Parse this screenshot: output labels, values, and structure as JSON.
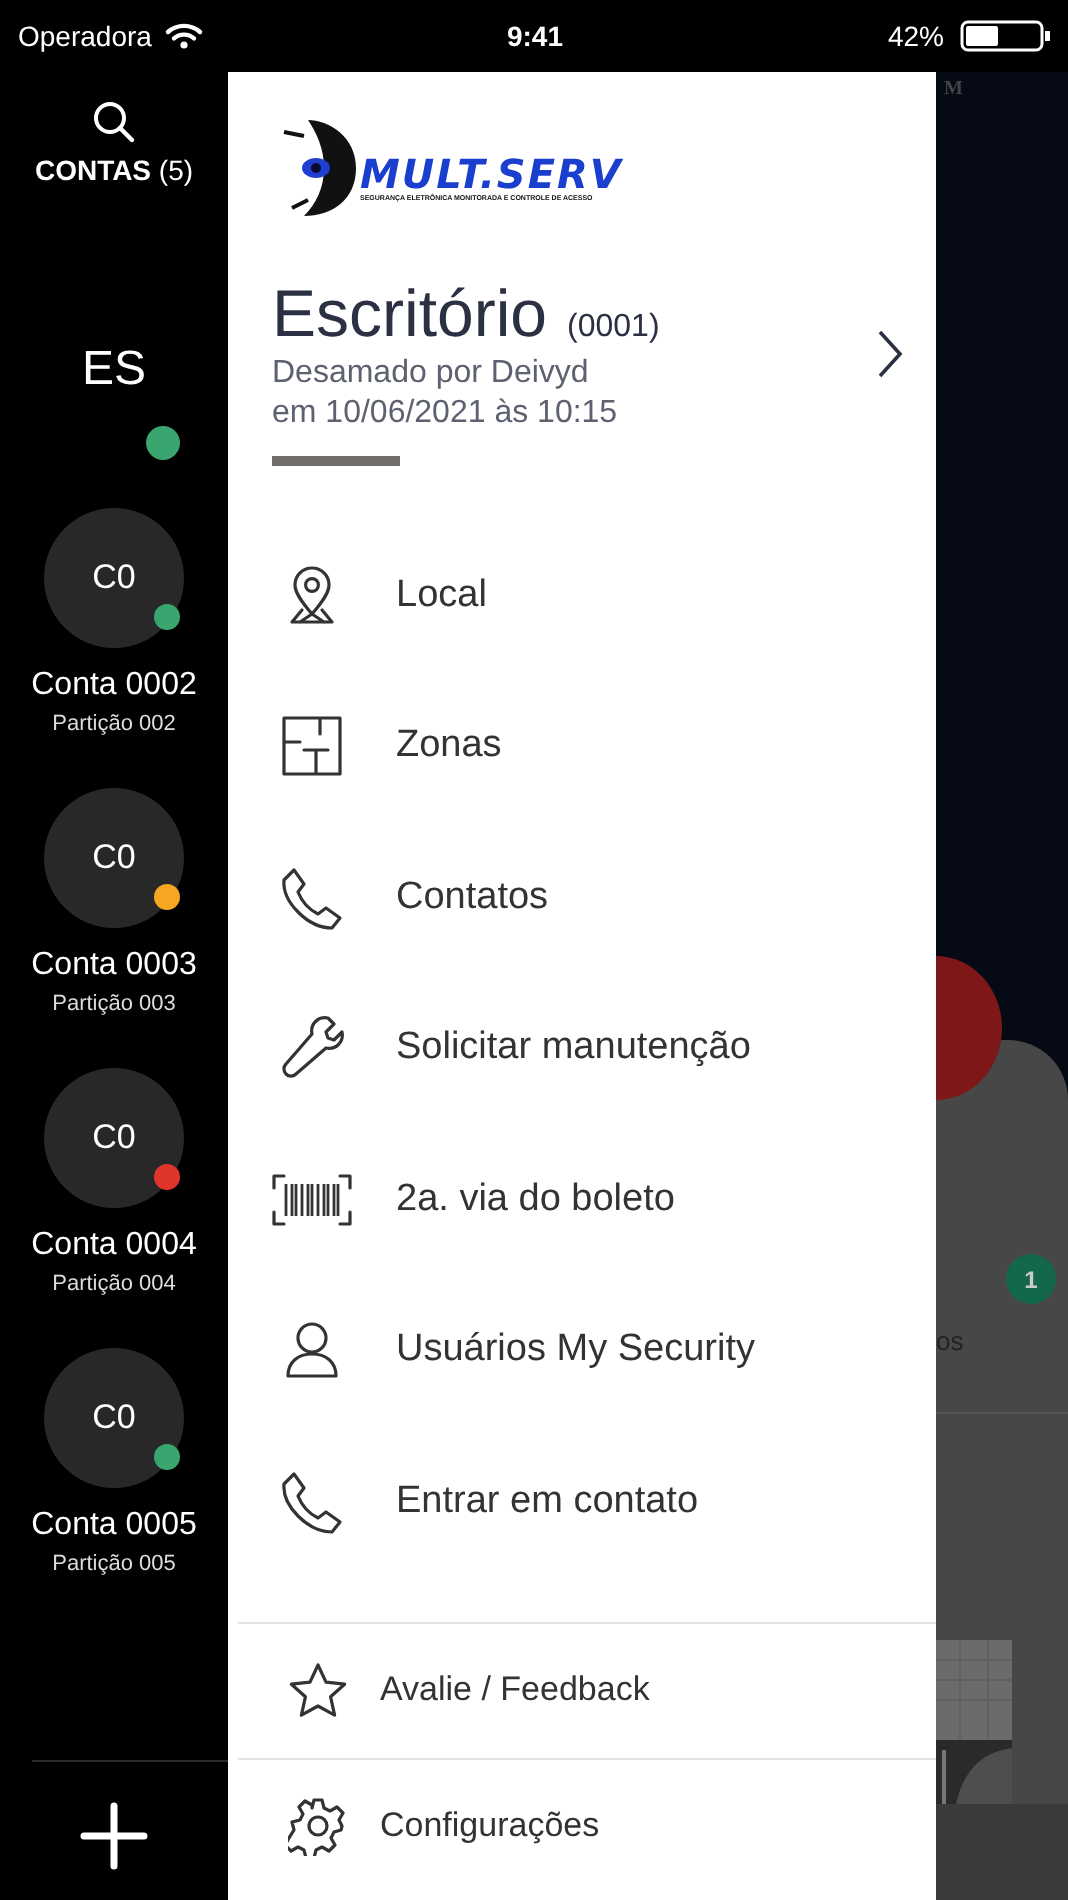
{
  "status_bar": {
    "carrier": "Operadora",
    "time": "9:41",
    "battery": "42%"
  },
  "sidebar": {
    "title": "**CONTAS** (5)",
    "current": {
      "initials": "ES",
      "color": "#3aa56f"
    },
    "accounts": [
      {
        "initials": "C0",
        "name": "Conta 0002",
        "partition": "Partição 002",
        "color": "#3aa56f"
      },
      {
        "initials": "C0",
        "name": "Conta 0003",
        "partition": "Partição 003",
        "color": "#f5a623"
      },
      {
        "initials": "C0",
        "name": "Conta 0004",
        "partition": "Partição 004",
        "color": "#e0352b"
      },
      {
        "initials": "C0",
        "name": "Conta 0005",
        "partition": "Partição 005",
        "color": "#3aa56f"
      }
    ]
  },
  "drawer": {
    "logo": {
      "name": "MULT.SERV",
      "tagline": "SEGURANÇA ELETRÔNICA MONITORADA E CONTROLE DE ACESSO"
    },
    "account": {
      "name": "Escritório",
      "code": "(0001)",
      "status": "Desamado por Deivyd",
      "time": "em  10/06/2021 às 10:15"
    },
    "menu": [
      {
        "label": "Local",
        "kind": "pin"
      },
      {
        "label": "Zonas",
        "kind": "plan"
      },
      {
        "label": "Contatos",
        "kind": "phone"
      },
      {
        "label": "Solicitar manutenção",
        "kind": "wrench"
      },
      {
        "label": "2a. via do boleto",
        "kind": "barcode"
      },
      {
        "label": "Usuários My Security",
        "kind": "person"
      },
      {
        "label": "Entrar em contato",
        "kind": "phone"
      }
    ],
    "footer": [
      {
        "label": "Avalie / Feedback",
        "kind": "star"
      },
      {
        "label": "Configurações",
        "kind": "gear"
      }
    ]
  },
  "background": {
    "mark": "M",
    "badge": "1",
    "label": "os"
  }
}
